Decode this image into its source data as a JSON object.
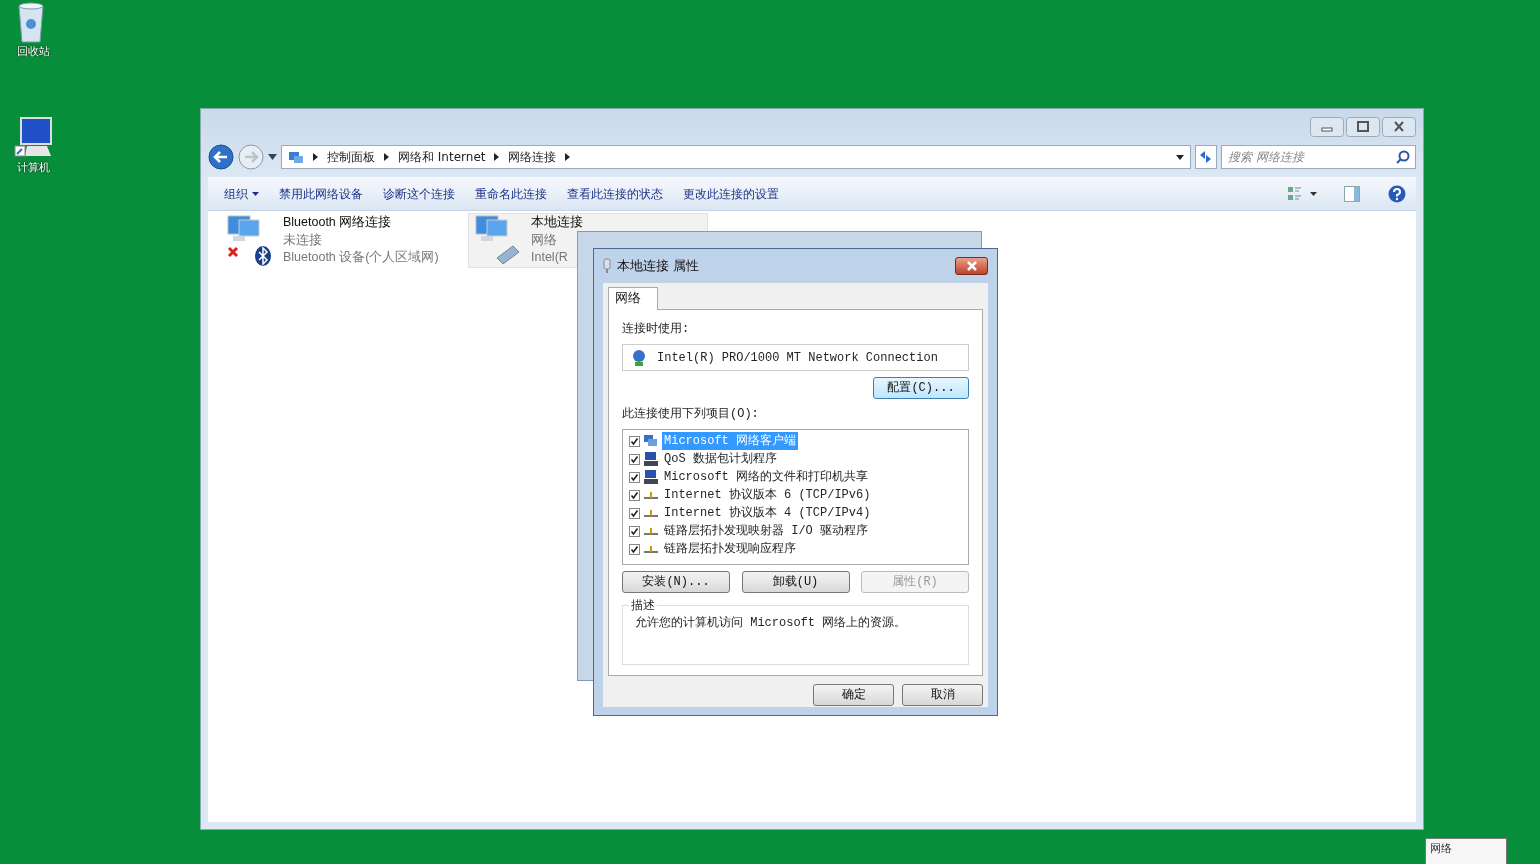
{
  "desktop_icons": [
    {
      "label": "回收站",
      "kind": "recycle"
    },
    {
      "label": "计算机",
      "kind": "computer"
    }
  ],
  "explorer": {
    "address": [
      "控制面板",
      "网络和 Internet",
      "网络连接"
    ],
    "search": {
      "placeholder": "搜索 网络连接"
    },
    "commands": [
      {
        "label": "组织",
        "dropdown": true
      },
      {
        "label": "禁用此网络设备",
        "dropdown": false
      },
      {
        "label": "诊断这个连接",
        "dropdown": false
      },
      {
        "label": "重命名此连接",
        "dropdown": false
      },
      {
        "label": "查看此连接的状态",
        "dropdown": false
      },
      {
        "label": "更改此连接的设置",
        "dropdown": false
      }
    ],
    "connections": [
      {
        "name": "Bluetooth 网络连接",
        "status": "未连接",
        "device": "Bluetooth 设备(个人区域网)",
        "kind": "bluetooth",
        "selected": false
      },
      {
        "name": "本地连接",
        "status": "网络",
        "device": "Intel(R",
        "kind": "ethernet",
        "selected": true
      }
    ]
  },
  "dialog": {
    "title": "本地连接 属性",
    "tabs": [
      {
        "label": "网络",
        "selected": true
      }
    ],
    "connect_using_label": "连接时使用:",
    "adapter": "Intel(R) PRO/1000 MT Network Connection",
    "configure_button": "配置(C)...",
    "items_label": "此连接使用下列项目(O):",
    "items": [
      {
        "label": "Microsoft 网络客户端",
        "checked": true,
        "selected": true,
        "kind": "client"
      },
      {
        "label": "QoS 数据包计划程序",
        "checked": true,
        "selected": false,
        "kind": "service"
      },
      {
        "label": "Microsoft 网络的文件和打印机共享",
        "checked": true,
        "selected": false,
        "kind": "service"
      },
      {
        "label": "Internet 协议版本 6 (TCP/IPv6)",
        "checked": true,
        "selected": false,
        "kind": "protocol"
      },
      {
        "label": "Internet 协议版本 4 (TCP/IPv4)",
        "checked": true,
        "selected": false,
        "kind": "protocol"
      },
      {
        "label": "链路层拓扑发现映射器 I/O 驱动程序",
        "checked": true,
        "selected": false,
        "kind": "protocol"
      },
      {
        "label": "链路层拓扑发现响应程序",
        "checked": true,
        "selected": false,
        "kind": "protocol"
      }
    ],
    "item_buttons": [
      {
        "label": "安装(N)...",
        "disabled": false
      },
      {
        "label": "卸载(U)",
        "disabled": false
      },
      {
        "label": "属性(R)",
        "disabled": true
      }
    ],
    "description_label": "描述",
    "description": "允许您的计算机访问 Microsoft 网络上的资源。",
    "footer_buttons": [
      {
        "label": "确定"
      },
      {
        "label": "取消"
      }
    ]
  },
  "tooltip": {
    "text": "网络"
  }
}
